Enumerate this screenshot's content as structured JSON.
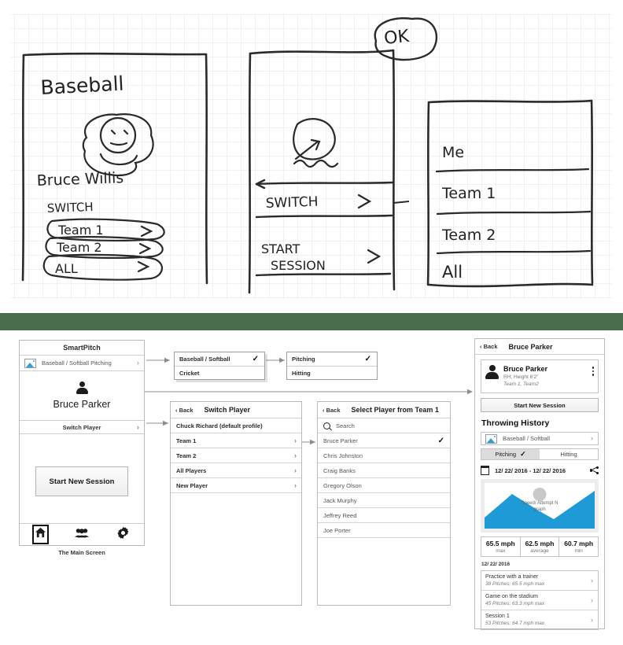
{
  "sketch": {
    "panel1": {
      "title": "Baseball",
      "name": "Bruce Willis",
      "switch_label": "SWITCH",
      "buttons": [
        "Team 1",
        "Team 2",
        "ALL"
      ]
    },
    "panel2": {
      "ok_label": "OK",
      "switch_label": "SWITCH >",
      "start_label_line1": "START",
      "start_label_line2": "SESSION >"
    },
    "panel3": {
      "items": [
        "Me",
        "Team 1",
        "Team 2",
        "All"
      ]
    }
  },
  "divider": {
    "color": "#4a6e4d"
  },
  "main_screen": {
    "title": "SmartPitch",
    "sport_row": {
      "label": "Baseball / Softball  Pitching",
      "icon": "image-icon",
      "chevron": "›"
    },
    "player_name": "Bruce Parker",
    "switch_player": "Switch Player",
    "start_button": "Start New Session",
    "tabs": [
      {
        "name": "home",
        "icon": "home-icon",
        "selected": true
      },
      {
        "name": "players",
        "icon": "people-icon",
        "selected": false
      },
      {
        "name": "settings",
        "icon": "gear-icon",
        "selected": false
      }
    ],
    "caption": "The Main Screen"
  },
  "dropdown_sport": {
    "items": [
      {
        "label": "Baseball / Softball",
        "checked": true
      },
      {
        "label": "Cricket",
        "checked": false
      }
    ]
  },
  "dropdown_mode": {
    "items": [
      {
        "label": "Pitching",
        "checked": true
      },
      {
        "label": "Hitting",
        "checked": false
      }
    ]
  },
  "switch_panel": {
    "back": "‹ Back",
    "title": "Switch Player",
    "default_profile": "Chuck Richard (default profile)",
    "items": [
      "Team 1",
      "Team 2",
      "All Players",
      "New Player"
    ]
  },
  "select_panel": {
    "back": "‹ Back",
    "title": "Select Player from Team 1",
    "search_placeholder": "Search",
    "players": [
      {
        "name": "Bruce Parker",
        "checked": true
      },
      {
        "name": "Chris Johnston",
        "checked": false
      },
      {
        "name": "Craig Banks",
        "checked": false
      },
      {
        "name": "Gregory Olson",
        "checked": false
      },
      {
        "name": "Jack Murphy",
        "checked": false
      },
      {
        "name": "Jeffrey Reed",
        "checked": false
      },
      {
        "name": "Joe Porter",
        "checked": false
      }
    ]
  },
  "detail_panel": {
    "back": "‹ Back",
    "title": "Bruce Parker",
    "card": {
      "name": "Bruce Parker",
      "meta": "RH; Height  6'2\"",
      "teams": "Team 1, Team2"
    },
    "start_button": "Start New Session",
    "history_heading": "Throwing History",
    "sport_row": "Baseball / Softball",
    "segments": [
      {
        "label": "Pitching",
        "selected": true
      },
      {
        "label": "Hitting",
        "selected": false
      }
    ],
    "date_range": "12/ 22/ 2016 - 12/ 22/ 2016",
    "chart_caption_line1": "Speed/ Attempt N",
    "chart_caption_line2": "graph",
    "stats": [
      {
        "value": "65.5 mph",
        "label": "max"
      },
      {
        "value": "62.5 mph",
        "label": "average"
      },
      {
        "value": "60.7 mph",
        "label": "min"
      }
    ],
    "session_date": "12/ 22/ 2016",
    "sessions": [
      {
        "title": "Practice with a trainer",
        "sub": "38 Pitches; 65.5 mph max"
      },
      {
        "title": "Game on the stadium",
        "sub": "45 Pitches; 63.3 mph max"
      },
      {
        "title": "Session 1",
        "sub": "53 Pitches; 64.7 mph max"
      }
    ]
  },
  "chart_data": {
    "type": "area",
    "title": "Speed/ Attempt N graph",
    "series_color": "#1e9ad6",
    "x": [
      0,
      1,
      2,
      3,
      4
    ],
    "values": [
      60.7,
      65.5,
      62.0,
      60.7,
      65.5
    ],
    "ylabel": "Speed (mph)",
    "xlabel": "Attempt N",
    "ylim": [
      60.7,
      65.5
    ]
  }
}
